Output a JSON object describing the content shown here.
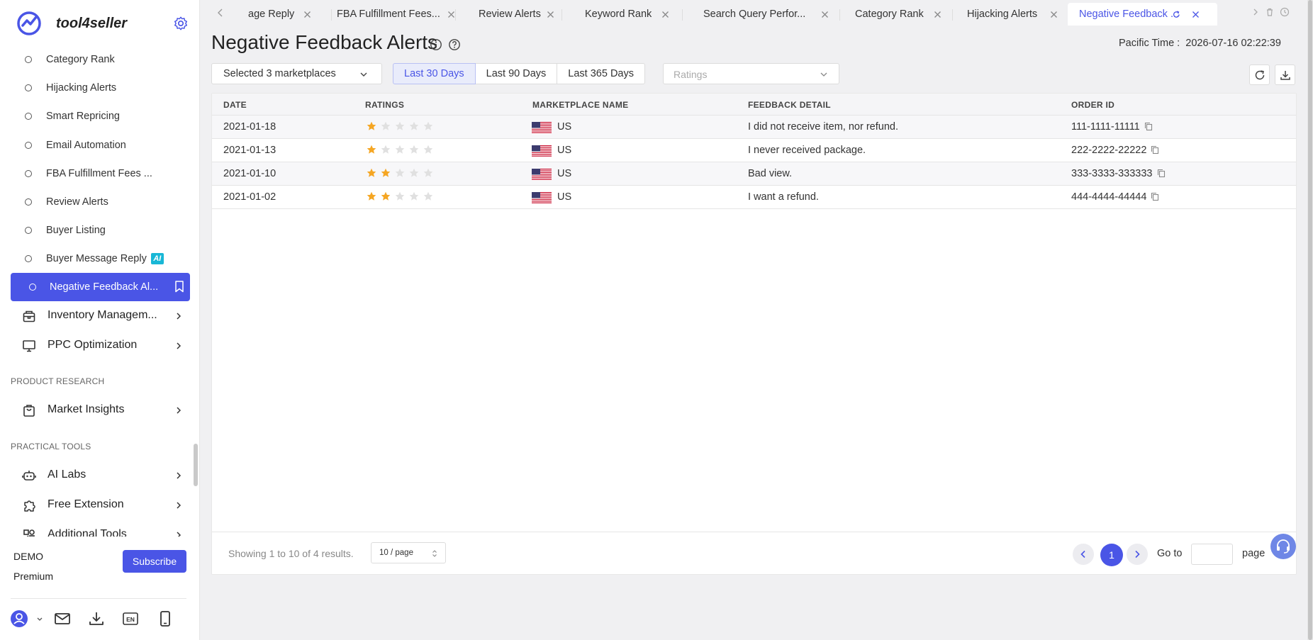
{
  "brand": {
    "name": "tool4seller"
  },
  "sidebar": {
    "sub_items": [
      {
        "label": "Category Rank"
      },
      {
        "label": "Hijacking Alerts"
      },
      {
        "label": "Smart Repricing"
      },
      {
        "label": "Email Automation"
      },
      {
        "label": "FBA Fulfillment Fees ..."
      },
      {
        "label": "Review Alerts"
      },
      {
        "label": "Buyer Listing"
      },
      {
        "label": "Buyer Message Reply",
        "badge": "AI"
      },
      {
        "label": "Negative Feedback Al...",
        "active": true
      }
    ],
    "groups": [
      {
        "label": "Inventory Managem...",
        "icon": "inventory-box-icon"
      },
      {
        "label": "PPC Optimization",
        "icon": "monitor-icon"
      }
    ],
    "sections": [
      {
        "title": "PRODUCT RESEARCH",
        "items": [
          {
            "label": "Market Insights",
            "icon": "shopping-bag-icon"
          }
        ]
      },
      {
        "title": "PRACTICAL TOOLS",
        "items": [
          {
            "label": "AI Labs",
            "icon": "robot-icon"
          },
          {
            "label": "Free Extension",
            "icon": "puzzle-icon"
          },
          {
            "label": "Additional Tools",
            "icon": "grid-tools-icon"
          }
        ]
      }
    ],
    "plan": {
      "tier": "DEMO",
      "level": "Premium",
      "subscribe_label": "Subscribe"
    },
    "footer_icons": [
      "user-icon",
      "mail-icon",
      "download-icon",
      "language-en-icon",
      "mobile-icon"
    ]
  },
  "tabs": [
    {
      "label": "age Reply"
    },
    {
      "label": "FBA Fulfillment Fees..."
    },
    {
      "label": "Review Alerts"
    },
    {
      "label": "Keyword Rank"
    },
    {
      "label": "Search Query Perfor..."
    },
    {
      "label": "Category Rank"
    },
    {
      "label": "Hijacking Alerts"
    },
    {
      "label": "Negative Feedback ...",
      "active": true
    }
  ],
  "page": {
    "title": "Negative Feedback Alerts",
    "time_label": "Pacific Time :  2026-07-16 02:22:39"
  },
  "filters": {
    "marketplaces": "Selected 3 marketplaces",
    "ranges": [
      {
        "label": "Last 30 Days",
        "active": true
      },
      {
        "label": "Last 90 Days"
      },
      {
        "label": "Last 365 Days"
      }
    ],
    "ratings_placeholder": "Ratings"
  },
  "table": {
    "columns": [
      "DATE",
      "RATINGS",
      "MARKETPLACE NAME",
      "FEEDBACK DETAIL",
      "ORDER ID"
    ],
    "rows": [
      {
        "date": "2021-01-18",
        "rating": 1,
        "marketplace": "US",
        "feedback": "I did not receive item, nor refund.",
        "order_id": "111-1111-11111"
      },
      {
        "date": "2021-01-13",
        "rating": 1,
        "marketplace": "US",
        "feedback": "I never received package.",
        "order_id": "222-2222-22222"
      },
      {
        "date": "2021-01-10",
        "rating": 2,
        "marketplace": "US",
        "feedback": "Bad view.",
        "order_id": "333-3333-333333"
      },
      {
        "date": "2021-01-02",
        "rating": 2,
        "marketplace": "US",
        "feedback": "I want a refund.",
        "order_id": "444-4444-44444"
      }
    ]
  },
  "pagination": {
    "showing": "Showing 1 to 10 of 4 results.",
    "page_size": "10 / page",
    "current_page": "1",
    "goto_label": "Go to",
    "page_label": "page"
  },
  "colors": {
    "accent": "#4a55e6",
    "star_on": "#f5a623",
    "star_off": "#e0e0e0",
    "ai_badge": "#18b7d6"
  }
}
